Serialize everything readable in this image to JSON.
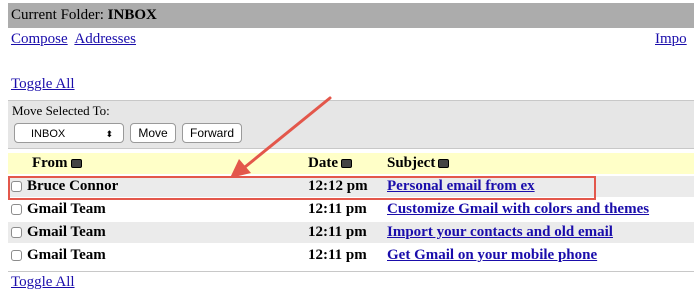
{
  "folder_bar": {
    "label": "Current Folder:",
    "value": "INBOX"
  },
  "nav": {
    "compose": "Compose",
    "addresses": "Addresses",
    "import": "Impo"
  },
  "toggle_all_top": "Toggle All",
  "move_panel": {
    "title": "Move Selected To:",
    "selected_folder": "INBOX",
    "select_arrow": "⬍",
    "move_label": "Move",
    "forward_label": "Forward"
  },
  "columns": {
    "from": "From",
    "date": "Date",
    "subject": "Subject"
  },
  "messages": [
    {
      "from": "Bruce Connor",
      "date": "12:12 pm",
      "subject": "Personal email from ex"
    },
    {
      "from": "Gmail Team",
      "date": "12:11 pm",
      "subject": "Customize Gmail with colors and themes"
    },
    {
      "from": "Gmail Team",
      "date": "12:11 pm",
      "subject": "Import your contacts and old email"
    },
    {
      "from": "Gmail Team",
      "date": "12:11 pm",
      "subject": "Get Gmail on your mobile phone"
    }
  ],
  "toggle_all_bottom": "Toggle All",
  "annotation_color": "#e3574b"
}
